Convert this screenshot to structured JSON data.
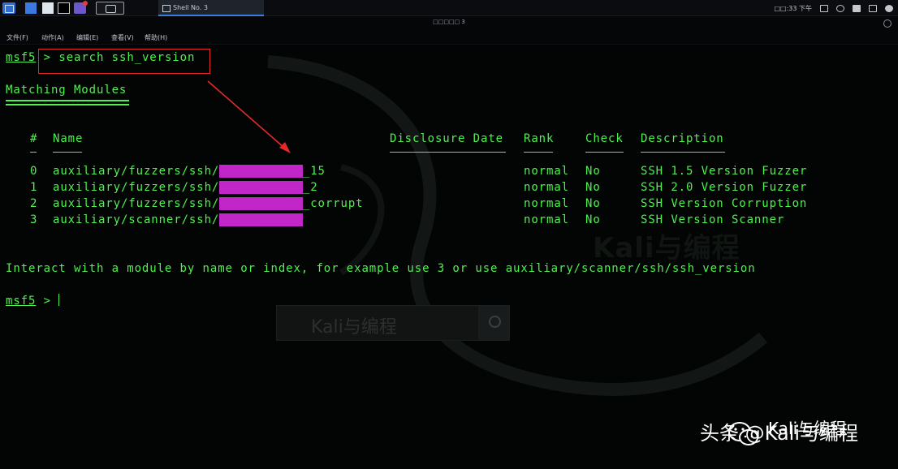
{
  "panel": {
    "task_title": "Shell No. 3",
    "clock": "□□:33 下午"
  },
  "window": {
    "title": "□□□□□ 3",
    "menu": [
      "文件(F)",
      "动作(A)",
      "编辑(E)",
      "查看(V)",
      "帮助(H)"
    ]
  },
  "terminal": {
    "prompt": "msf5",
    "prompt_arrow": ">",
    "command": "search ssh_version",
    "section_title": "Matching Modules",
    "headers": {
      "num": "#",
      "name": "Name",
      "date": "Disclosure Date",
      "rank": "Rank",
      "check": "Check",
      "description": "Description"
    },
    "modules": [
      {
        "index": "0",
        "path": "auxiliary/fuzzers/ssh/",
        "match": "ssh_version",
        "suffix": "_15",
        "rank": "normal",
        "check": "No",
        "description": "SSH 1.5 Version Fuzzer"
      },
      {
        "index": "1",
        "path": "auxiliary/fuzzers/ssh/",
        "match": "ssh_version",
        "suffix": "_2",
        "rank": "normal",
        "check": "No",
        "description": "SSH 2.0 Version Fuzzer"
      },
      {
        "index": "2",
        "path": "auxiliary/fuzzers/ssh/",
        "match": "ssh_version",
        "suffix": "_corrupt",
        "rank": "normal",
        "check": "No",
        "description": "SSH Version Corruption"
      },
      {
        "index": "3",
        "path": "auxiliary/scanner/ssh/",
        "match": "ssh_version",
        "suffix": "",
        "rank": "normal",
        "check": "No",
        "description": "SSH Version Scanner"
      }
    ],
    "hint": "Interact with a module by name or index, for example use 3 or use auxiliary/scanner/ssh/ssh_version",
    "prompt2": "msf5",
    "prompt2_arrow": ">"
  },
  "watermarks": {
    "center_logo": "Kali与编程",
    "search_text": "Kali与编程",
    "brand_prefix": "头条",
    "brand_handle": "@Kali与编程",
    "brand_top": "Kali与编程"
  },
  "colors": {
    "terminal_green": "#4ff14f",
    "highlight_magenta": "#c126c8",
    "annotation_red": "#e22a2a"
  }
}
